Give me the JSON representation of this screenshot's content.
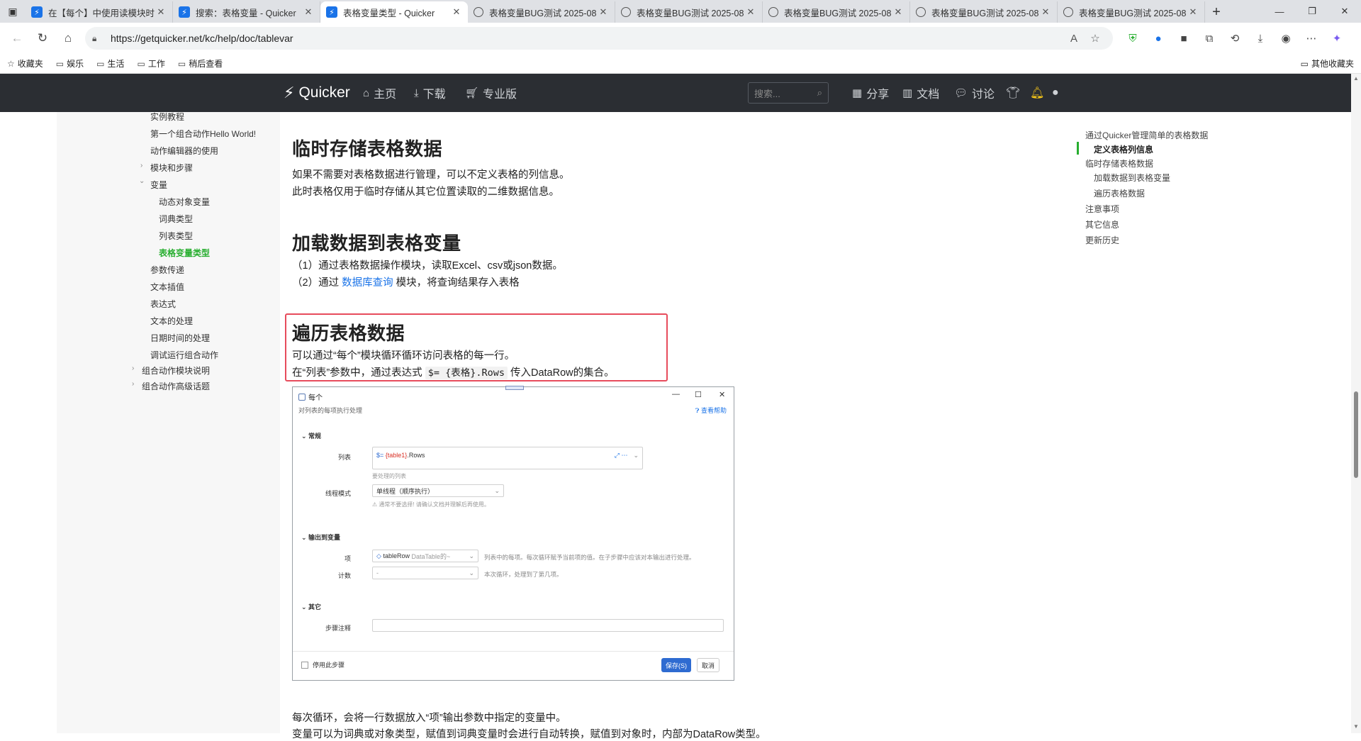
{
  "browser": {
    "tabs": [
      {
        "title": "在【每个】中使用读模块时",
        "icon": "quicker-icon",
        "active": false
      },
      {
        "title": "搜索：表格变量 - Quicker",
        "icon": "quicker-icon",
        "active": false
      },
      {
        "title": "表格变量类型 - Quicker",
        "icon": "quicker-icon",
        "active": true
      },
      {
        "title": "表格变量BUG测试 2025-08",
        "icon": "globe-icon",
        "active": false
      },
      {
        "title": "表格变量BUG测试 2025-08",
        "icon": "globe-icon",
        "active": false
      },
      {
        "title": "表格变量BUG测试 2025-08",
        "icon": "globe-icon",
        "active": false
      },
      {
        "title": "表格变量BUG测试 2025-08",
        "icon": "globe-icon",
        "active": false
      },
      {
        "title": "表格变量BUG测试 2025-08",
        "icon": "globe-icon",
        "active": false
      }
    ],
    "url": "https://getquicker.net/kc/help/doc/tablevar",
    "favorites": [
      {
        "label": "收藏夹",
        "icon": "star-icon"
      },
      {
        "label": "娱乐",
        "icon": "folder-icon"
      },
      {
        "label": "生活",
        "icon": "folder-icon"
      },
      {
        "label": "工作",
        "icon": "folder-icon"
      },
      {
        "label": "稍后查看",
        "icon": "folder-icon"
      }
    ],
    "other_favorites": "其他收藏夹"
  },
  "site": {
    "brand": "Quicker",
    "nav": [
      {
        "label": "主页",
        "icon": "home-icon"
      },
      {
        "label": "下载",
        "icon": "download-icon"
      },
      {
        "label": "专业版",
        "icon": "cart-icon"
      }
    ],
    "search_placeholder": "搜索...",
    "right_nav": [
      {
        "label": "分享",
        "icon": "grid-icon"
      },
      {
        "label": "文档",
        "icon": "library-icon"
      },
      {
        "label": "讨论",
        "icon": "comments-icon"
      }
    ]
  },
  "sidebar": {
    "items": [
      {
        "label": "实例教程",
        "active": false,
        "caret": ""
      },
      {
        "label": "第一个组合动作Hello World!",
        "active": false,
        "caret": ""
      },
      {
        "label": "动作编辑器的使用",
        "active": false,
        "caret": ""
      },
      {
        "label": "模块和步骤",
        "active": false,
        "caret": "›"
      },
      {
        "label": "变量",
        "active": false,
        "caret": "⌄"
      },
      {
        "label": "动态对象变量",
        "active": false,
        "caret": ""
      },
      {
        "label": "词典类型",
        "active": false,
        "caret": ""
      },
      {
        "label": "列表类型",
        "active": false,
        "caret": ""
      },
      {
        "label": "表格变量类型",
        "active": true,
        "caret": ""
      },
      {
        "label": "参数传递",
        "active": false,
        "caret": ""
      },
      {
        "label": "文本插值",
        "active": false,
        "caret": ""
      },
      {
        "label": "表达式",
        "active": false,
        "caret": ""
      },
      {
        "label": "文本的处理",
        "active": false,
        "caret": ""
      },
      {
        "label": "日期时间的处理",
        "active": false,
        "caret": ""
      },
      {
        "label": "调试运行组合动作",
        "active": false,
        "caret": ""
      },
      {
        "label": "组合动作模块说明",
        "active": false,
        "caret": "›"
      },
      {
        "label": "组合动作高级话题",
        "active": false,
        "caret": "›"
      }
    ]
  },
  "content": {
    "sec1": {
      "title": "临时存储表格数据",
      "p1": "如果不需要对表格数据进行管理，可以不定义表格的列信息。",
      "p2": "此时表格仅用于临时存储从其它位置读取的二维数据信息。"
    },
    "sec2": {
      "title": "加载数据到表格变量",
      "item1": "（1）通过表格数据操作模块，读取Excel、csv或json数据。",
      "item2_pre": "（2）通过 ",
      "item2_link": "数据库查询",
      "item2_post": " 模块，将查询结果存入表格"
    },
    "sec3": {
      "title": "遍历表格数据",
      "p1": "可以通过“每个”模块循环循环访问表格的每一行。",
      "p2_pre": "在“列表”参数中，通过表达式 ",
      "p2_code": "$= {表格}.Rows",
      "p2_post": " 传入DataRow的集合。"
    },
    "after1": "每次循环，会将一行数据放入“项”输出参数中指定的变量中。",
    "after2": "变量可以为词典或对象类型，赋值到词典变量时会进行自动转换，赋值到对象时，内部为DataRow类型。"
  },
  "dialog": {
    "title": "每个",
    "subtitle": "对列表的每项执行处理",
    "help": "查看帮助",
    "section_general": "常规",
    "list_label": "列表",
    "list_expr_prefix": "$=",
    "list_expr_var": "{table1}",
    "list_expr_suffix": ".Rows",
    "list_hint": "要处理的列表",
    "thread_label": "线程模式",
    "thread_value": "单线程（顺序执行）",
    "thread_hint": "通常不要选择! 请确认文档并理解后再使用。",
    "section_output": "输出到变量",
    "item_label": "项",
    "item_value": "tableRow",
    "item_type": "DataTable的~",
    "item_desc": "列表中的每项。每次循环赋予当前项的值。在子步骤中应该对本输出进行处理。",
    "count_label": "计数",
    "count_value": "-",
    "count_desc": "本次循环，处理到了第几项。",
    "section_other": "其它",
    "note_label": "步骤注释",
    "disable_label": "停用此步骤",
    "save_label": "保存(S)",
    "cancel_label": "取消"
  },
  "toc": {
    "items": [
      {
        "label": "通过Quicker管理简单的表格数据",
        "indent": false,
        "active": false
      },
      {
        "label": "定义表格列信息",
        "indent": true,
        "active": true
      },
      {
        "label": "临时存储表格数据",
        "indent": false,
        "active": false
      },
      {
        "label": "加载数据到表格变量",
        "indent": true,
        "active": false
      },
      {
        "label": "遍历表格数据",
        "indent": true,
        "active": false
      },
      {
        "label": "注意事项",
        "indent": false,
        "active": false
      },
      {
        "label": "其它信息",
        "indent": false,
        "active": false
      },
      {
        "label": "更新历史",
        "indent": false,
        "active": false
      }
    ]
  },
  "colors": {
    "accent_green": "#27ae2f",
    "link_blue": "#1a73e8",
    "highlight_red": "#e74c5c",
    "header_dark": "#2b2e33",
    "bell_yellow": "#f5c518"
  }
}
